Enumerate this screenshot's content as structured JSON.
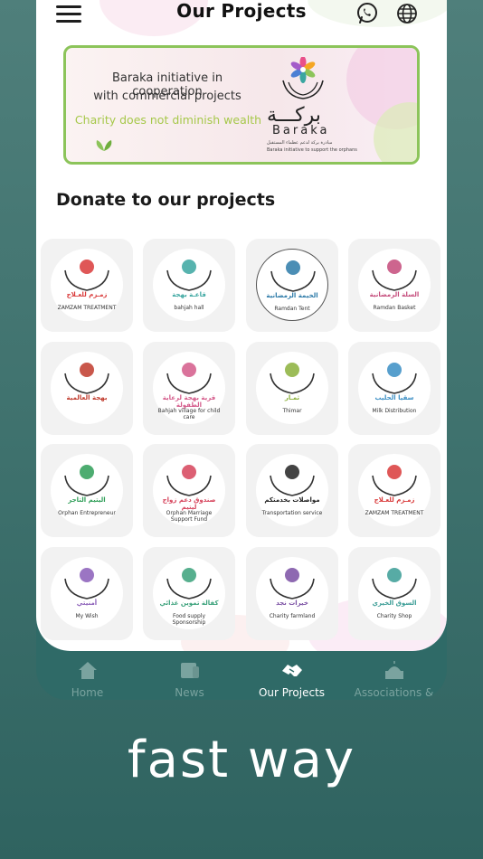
{
  "header": {
    "title": "Our Projects",
    "menu_icon": "menu-icon",
    "whatsapp_icon": "whatsapp-icon",
    "globe_icon": "globe-icon"
  },
  "banner": {
    "line1": "Baraka initiative in cooperation",
    "line2": "with commercial projects",
    "tagline": "Charity does not diminish wealth",
    "brand_ar": "بركـــة",
    "brand_en": "Baraka",
    "brand_sub_ar": "مبادرة بركة لدعم عظماء المستقبل",
    "brand_sub_en": "Baraka initiative to support the orphans",
    "accent": "#8cc45a"
  },
  "section": {
    "title": "Donate to our projects"
  },
  "projects": [
    {
      "ar": "زمـزم للعـلاج",
      "en": "ZAMZAM TREATMENT",
      "color": "#d93a3a"
    },
    {
      "ar": "قاعـة بهجة",
      "en": "bahjah hall",
      "color": "#3aa6a0"
    },
    {
      "ar": "الخيمة الرمضانية",
      "en": "Ramdan Tent",
      "color": "#2c7aa8"
    },
    {
      "ar": "السلة الرمضانية",
      "en": "Ramdan Basket",
      "color": "#c44a7a"
    },
    {
      "ar": "بهجة العالمية",
      "en": "",
      "color": "#c0392b"
    },
    {
      "ar": "قرية بهجة لرعاية الطفولة",
      "en": "Bahjah village for child care",
      "color": "#d45a8a"
    },
    {
      "ar": "ثمـار",
      "en": "Thimar",
      "color": "#8bb03b"
    },
    {
      "ar": "سقيا الحليب",
      "en": "Milk Distribution",
      "color": "#3a8ec4"
    },
    {
      "ar": "اليتيم التاجر",
      "en": "Orphan Entrepreneur",
      "color": "#2e9e57"
    },
    {
      "ar": "صندوق دعم زواج ليتيم",
      "en": "Orphan Marriage Support Fund",
      "color": "#d6435b"
    },
    {
      "ar": "مواصلات بخدمتكم",
      "en": "Transportation service",
      "color": "#222222"
    },
    {
      "ar": "زمـزم للعـلاج",
      "en": "ZAMZAM TREATMENT",
      "color": "#d93a3a"
    },
    {
      "ar": "أمنيتي",
      "en": "My Wish",
      "color": "#8a5db8"
    },
    {
      "ar": "كفالة تموين غذائي",
      "en": "Food supply Sponsorship",
      "color": "#3aa17a"
    },
    {
      "ar": "خيرات نجد",
      "en": "Charity farmland",
      "color": "#7a4fa3"
    },
    {
      "ar": "السوق الخيري",
      "en": "Charity Shop",
      "color": "#3a9c95"
    }
  ],
  "tabbar": {
    "items": [
      {
        "label": "Home",
        "icon": "home-icon"
      },
      {
        "label": "News",
        "icon": "news-icon"
      },
      {
        "label": "Our Projects",
        "icon": "handshake-icon"
      },
      {
        "label": "Associations &",
        "icon": "mosque-icon"
      }
    ],
    "active": 2
  },
  "slogan": "fast way",
  "colors": {
    "brand_teal": "#2f6a67",
    "background": "#4f7f7b",
    "tab_inactive": "#7aa39f"
  }
}
